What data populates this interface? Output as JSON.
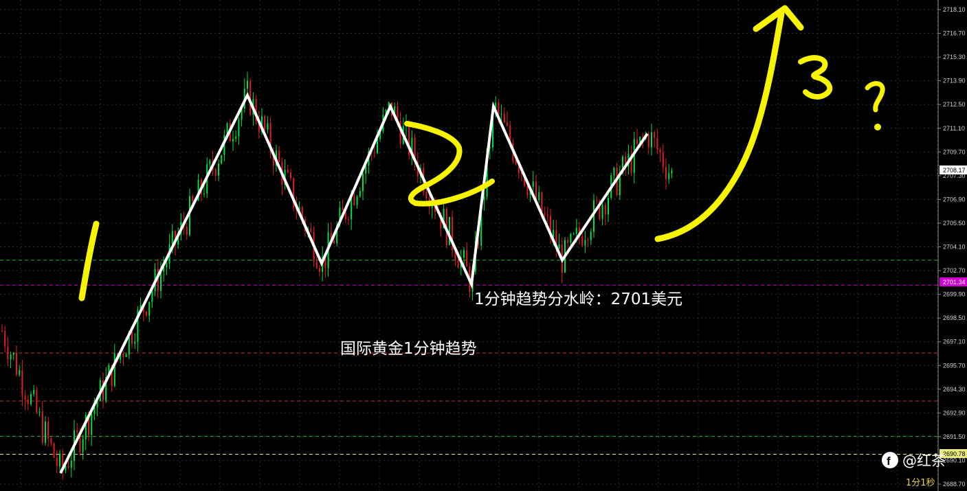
{
  "chart_data": {
    "type": "candlestick",
    "timeframe": "1分1秒",
    "y_axis_ticks": [
      "2718.10",
      "2716.70",
      "2715.30",
      "2713.90",
      "2712.50",
      "2711.10",
      "2709.70",
      "2707.30",
      "2706.90",
      "2705.50",
      "2704.10",
      "2702.70",
      "2699.90",
      "2698.50",
      "2697.10",
      "2695.70",
      "2694.30",
      "2692.90",
      "2691.50",
      "2690.10",
      "2688.70"
    ],
    "ylim": [
      2688.7,
      2718.8
    ],
    "current_price": "2708.17",
    "key_level_label": "2701.34",
    "low_level_label": "2690.78",
    "annotations": {
      "watershed": "1分钟趋势分水岭：2701美元",
      "title": "国际黄金1分钟趋势",
      "wave_1": "1",
      "wave_2": "2",
      "wave_3": "3",
      "question": "?"
    },
    "zigzag_path": [
      2689.6,
      2713.2,
      2702.7,
      2712.5,
      2701.4,
      2712.5,
      2702.9,
      2710.8
    ],
    "horizontal_levels": [
      {
        "price": 2702.9,
        "color": "#2db52d",
        "style": "dashed"
      },
      {
        "price": 2701.34,
        "color": "#d000d0",
        "style": "dashed"
      },
      {
        "price": 2697.1,
        "color": "#c83030",
        "style": "dashed"
      },
      {
        "price": 2694.1,
        "color": "#c83030",
        "style": "dashed"
      },
      {
        "price": 2691.9,
        "color": "#2db52d",
        "style": "dashed"
      },
      {
        "price": 2690.78,
        "color": "#e8e880",
        "style": "dashed"
      }
    ],
    "colors": {
      "up": "#00e040",
      "down": "#e02020",
      "grid": "#1e3a1e",
      "annotation": "#ffffff",
      "handwriting": "#f8f400"
    }
  },
  "watermark": {
    "text": "@红茶"
  }
}
